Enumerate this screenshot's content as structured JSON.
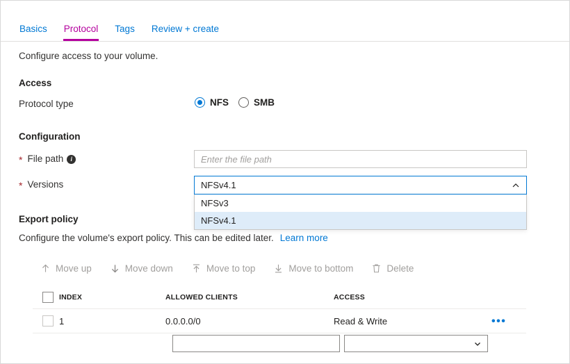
{
  "tabs": [
    {
      "label": "Basics",
      "active": false
    },
    {
      "label": "Protocol",
      "active": true
    },
    {
      "label": "Tags",
      "active": false
    },
    {
      "label": "Review + create",
      "active": false
    }
  ],
  "intro": "Configure access to your volume.",
  "sections": {
    "access": {
      "heading": "Access",
      "protocol_label": "Protocol type",
      "options": [
        {
          "label": "NFS",
          "checked": true
        },
        {
          "label": "SMB",
          "checked": false
        }
      ]
    },
    "configuration": {
      "heading": "Configuration",
      "file_path_label": "File path",
      "file_path_required": "*",
      "file_path_info_icon": "info-icon",
      "file_path_value": "",
      "file_path_placeholder": "Enter the file path",
      "versions_label": "Versions",
      "versions_required": "*",
      "versions_value": "NFSv4.1",
      "versions_chevron_icon": "chevron-up-icon",
      "versions_options": [
        {
          "label": "NFSv3",
          "selected": false
        },
        {
          "label": "NFSv4.1",
          "selected": true
        }
      ]
    },
    "export_policy": {
      "heading": "Export policy",
      "description": "Configure the volume's export policy. This can be edited later.",
      "learn_more": "Learn more"
    }
  },
  "toolbar": [
    {
      "label": "Move up",
      "icon": "arrow-up-icon"
    },
    {
      "label": "Move down",
      "icon": "arrow-down-icon"
    },
    {
      "label": "Move to top",
      "icon": "arrow-to-top-icon"
    },
    {
      "label": "Move to bottom",
      "icon": "arrow-to-bottom-icon"
    },
    {
      "label": "Delete",
      "icon": "trash-icon"
    }
  ],
  "table": {
    "columns": [
      "INDEX",
      "ALLOWED CLIENTS",
      "ACCESS"
    ],
    "rows": [
      {
        "index": "1",
        "allowed_clients": "0.0.0.0/0",
        "access": "Read & Write",
        "more": "•••"
      }
    ]
  },
  "edit_row": {
    "text_value": "",
    "text_placeholder": "",
    "select_value": "",
    "select_chevron_icon": "chevron-down-icon"
  },
  "colors": {
    "link": "#0078d4",
    "active_tab": "#b4009e",
    "required": "#a4262c",
    "selected_option_bg": "#deecf9",
    "disabled_text": "#a19f9d"
  }
}
